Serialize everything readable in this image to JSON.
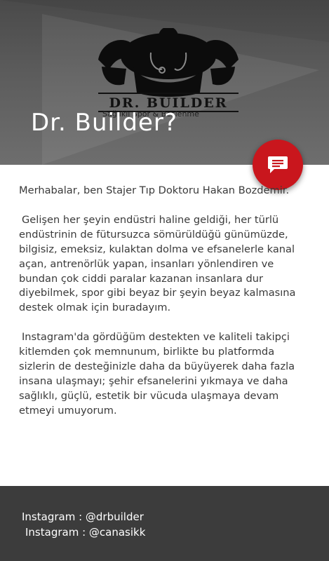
{
  "header": {
    "brand": "DR. BUILDER",
    "tagline": "Sağlıklı Spor & Beslenme",
    "title": "Dr. Builder?"
  },
  "fab": {
    "icon": "message-icon"
  },
  "content": {
    "intro": "Merhabalar, ben Stajer Tıp Doktoru Hakan Bozdemir.",
    "paragraph1": "Gelişen her şeyin endüstri haline geldiği, her türlü endüstrinin de fütursuzca sömürüldüğü günümüzde, bilgisiz, emeksiz, kulaktan dolma ve efsanelerle kanal açan, antrenörlük yapan, insanları yönlendiren ve bundan çok ciddi paralar kazanan insanlara dur diyebilmek, spor gibi beyaz bir şeyin beyaz kalmasına destek olmak için buradayım.",
    "paragraph2": "Instagram'da gördüğüm destekten ve kaliteli takipçi kitlemden çok memnunum, birlikte bu platformda sizlerin de desteğinizle daha da büyüyerek daha fazla insana ulaşmayı; şehir efsanelerini yıkmaya ve daha sağlıklı, güçlü, estetik bir vücuda ulaşmaya devam etmeyi umuyorum."
  },
  "footer": {
    "instagram1": "Instagram : @drbuilder",
    "instagram2": "Instagram : @canasikk"
  },
  "colors": {
    "accent": "#c9161d",
    "footer_bg": "#3c3c3c",
    "header_bg": "#555555"
  }
}
